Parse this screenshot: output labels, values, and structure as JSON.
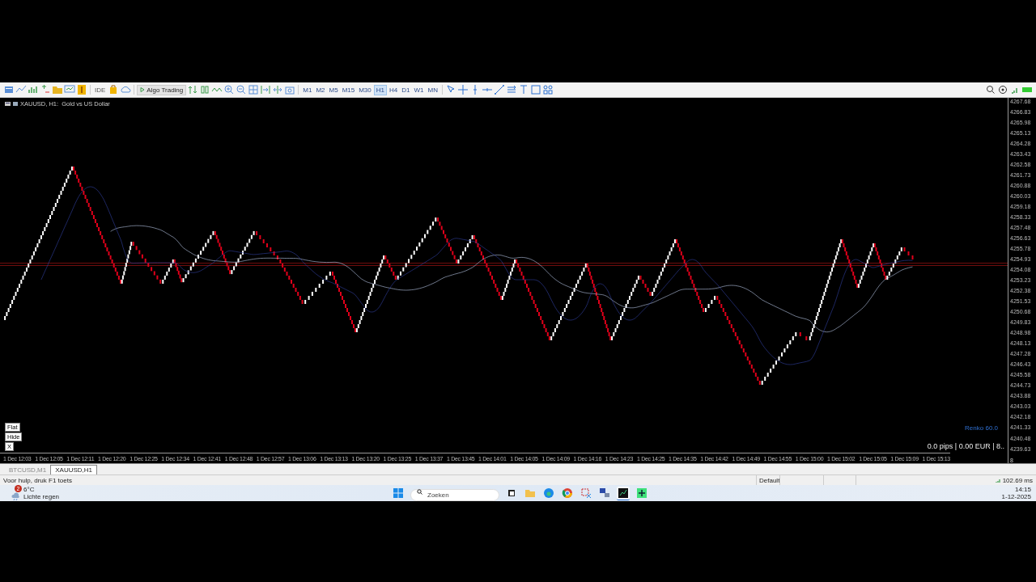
{
  "toolbar": {
    "ide_label": "IDE",
    "algo_trading": "Algo Trading",
    "timeframes": [
      {
        "label": "M1",
        "selected": false
      },
      {
        "label": "M2",
        "selected": false
      },
      {
        "label": "M5",
        "selected": false
      },
      {
        "label": "M15",
        "selected": false
      },
      {
        "label": "M30",
        "selected": false
      },
      {
        "label": "H1",
        "selected": true
      },
      {
        "label": "H4",
        "selected": false
      },
      {
        "label": "D1",
        "selected": false
      },
      {
        "label": "W1",
        "selected": false
      },
      {
        "label": "MN",
        "selected": false
      }
    ]
  },
  "chart": {
    "title": "XAUUSD, H1:  Gold vs US Dollar",
    "price_ticks": [
      "4267.68",
      "4266.83",
      "4265.98",
      "4265.13",
      "4264.28",
      "4263.43",
      "4262.58",
      "4261.73",
      "4260.88",
      "4260.03",
      "4259.18",
      "4258.33",
      "4257.48",
      "4256.63",
      "4255.78",
      "4254.93",
      "4254.08",
      "4253.23",
      "4252.38",
      "4251.53",
      "4250.68",
      "4249.83",
      "4248.98",
      "4248.13",
      "4247.28",
      "4246.43",
      "4245.58",
      "4244.73",
      "4243.88",
      "4243.03",
      "4242.18",
      "4241.33",
      "4240.48",
      "4239.63"
    ],
    "time_ticks": [
      "1 Dec 12:03",
      "1 Dec 12:05",
      "1 Dec 12:11",
      "1 Dec 12:20",
      "1 Dec 12:25",
      "1 Dec 12:34",
      "1 Dec 12:41",
      "1 Dec 12:48",
      "1 Dec 12:57",
      "1 Dec 13:06",
      "1 Dec 13:13",
      "1 Dec 13:20",
      "1 Dec 13:25",
      "1 Dec 13:37",
      "1 Dec 13:45",
      "1 Dec 14:01",
      "1 Dec 14:05",
      "1 Dec 14:09",
      "1 Dec 14:16",
      "1 Dec 14:23",
      "1 Dec 14:25",
      "1 Dec 14:35",
      "1 Dec 14:42",
      "1 Dec 14:49",
      "1 Dec 14:55",
      "1 Dec 15:00",
      "1 Dec 15:02",
      "1 Dec 15:05",
      "1 Dec 15:09",
      "1 Dec 15:13"
    ],
    "axis_corner": "8",
    "overlay_buttons": [
      "Flat",
      "Hide",
      "X"
    ],
    "renko_label": "Renko 60.0",
    "pnl_info": "0.0 pips | 0.00 EUR | 8.."
  },
  "chart_tabs": [
    {
      "label": "BTCUSD,M1",
      "selected": false
    },
    {
      "label": "XAUUSD,H1",
      "selected": true
    }
  ],
  "status_bar": {
    "help": "Voor hulp, druk F1 toets",
    "profile": "Default",
    "ping": "102.69 ms"
  },
  "taskbar": {
    "weather": {
      "badge": "2",
      "temperature": "6°C",
      "condition": "Lichte regen"
    },
    "search": {
      "placeholder": "Zoeken"
    },
    "clock": {
      "time": "14:15",
      "date": "1-12-2025"
    }
  }
}
